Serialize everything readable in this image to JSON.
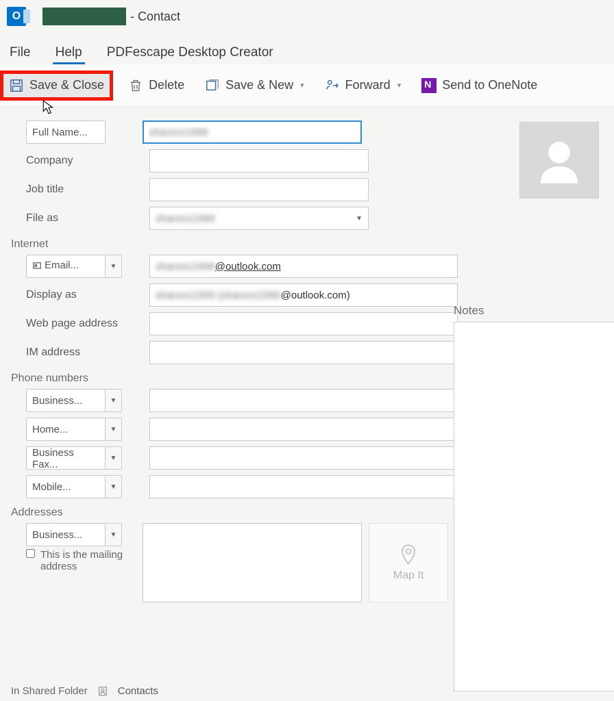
{
  "title": {
    "suffix": " - Contact"
  },
  "menu": {
    "file": "File",
    "help": "Help",
    "pdfescape": "PDFescape Desktop Creator"
  },
  "ribbon": {
    "save_close": "Save & Close",
    "delete": "Delete",
    "save_new": "Save & New",
    "forward": "Forward",
    "onenote": "Send to OneNote"
  },
  "form": {
    "full_name_btn": "Full Name...",
    "full_name_value": "sharonz1996",
    "company_label": "Company",
    "jobtitle_label": "Job title",
    "fileas_label": "File as",
    "fileas_value": "sharonz1996",
    "internet_section": "Internet",
    "email_btn": "Email...",
    "email_blur": "sharonz1996",
    "email_suffix": "@outlook.com",
    "displayas_label": "Display as",
    "displayas_blur": "sharonz1996 (sharonz1996",
    "displayas_suffix": "@outlook.com)",
    "webpage_label": "Web page address",
    "im_label": "IM address",
    "phones_section": "Phone numbers",
    "phone_business": "Business...",
    "phone_home": "Home...",
    "phone_fax": "Business Fax...",
    "phone_mobile": "Mobile...",
    "addresses_section": "Addresses",
    "addr_business": "Business...",
    "mailing_chk": "This is the mailing address",
    "map_it": "Map It"
  },
  "notes_label": "Notes",
  "status": {
    "folder": "In Shared Folder",
    "contacts": "Contacts"
  }
}
